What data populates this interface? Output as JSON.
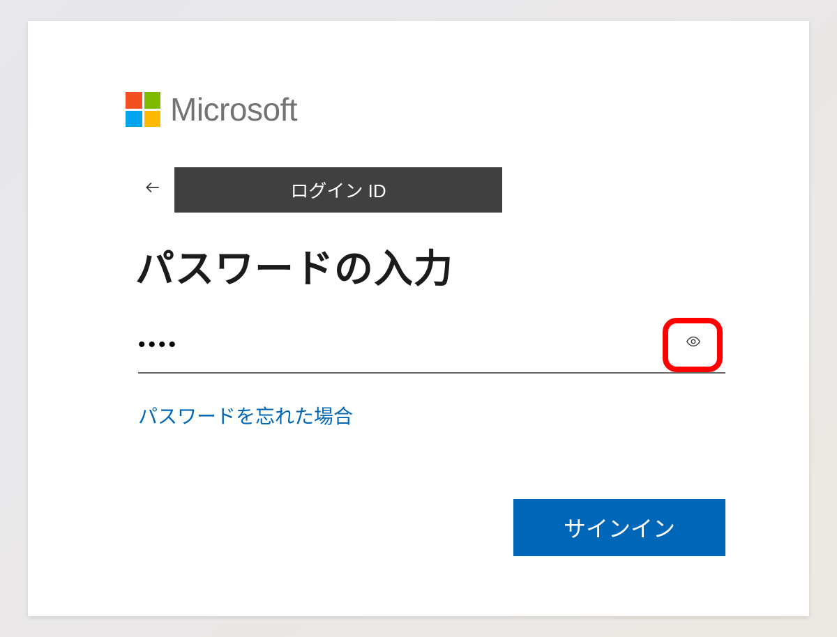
{
  "brand": {
    "name": "Microsoft"
  },
  "identity": {
    "label": "ログイン ID"
  },
  "title": "パスワードの入力",
  "password": {
    "value": "••••",
    "placeholder": ""
  },
  "links": {
    "forgot": "パスワードを忘れた場合"
  },
  "buttons": {
    "signin": "サインイン"
  }
}
